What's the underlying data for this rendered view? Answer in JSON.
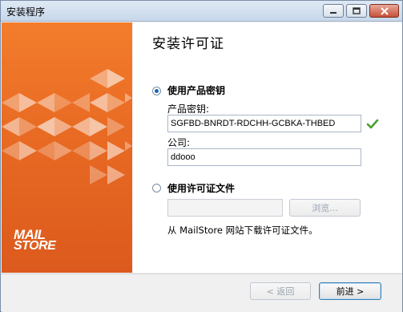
{
  "window": {
    "title": "安装程序"
  },
  "brand": {
    "logo_top": "MAIL",
    "logo_bottom": "STORE"
  },
  "page": {
    "title": "安装许可证"
  },
  "options": {
    "use_product_key": {
      "label": "使用产品密钥",
      "selected": true,
      "key_label": "产品密钥:",
      "key_value": "SGFBD-BNRDT-RDCHH-GCBKA-THBED",
      "company_label": "公司:",
      "company_value": "ddooo"
    },
    "use_license_file": {
      "label": "使用许可证文件",
      "selected": false,
      "path_value": "",
      "browse_label": "浏览...",
      "hint": "从 MailStore 网站下载许可证文件。"
    }
  },
  "footer": {
    "back_label": "< 返回",
    "next_label": "前进 >"
  },
  "colors": {
    "accent_orange": "#e86a23",
    "check_green": "#4c9f2f"
  }
}
